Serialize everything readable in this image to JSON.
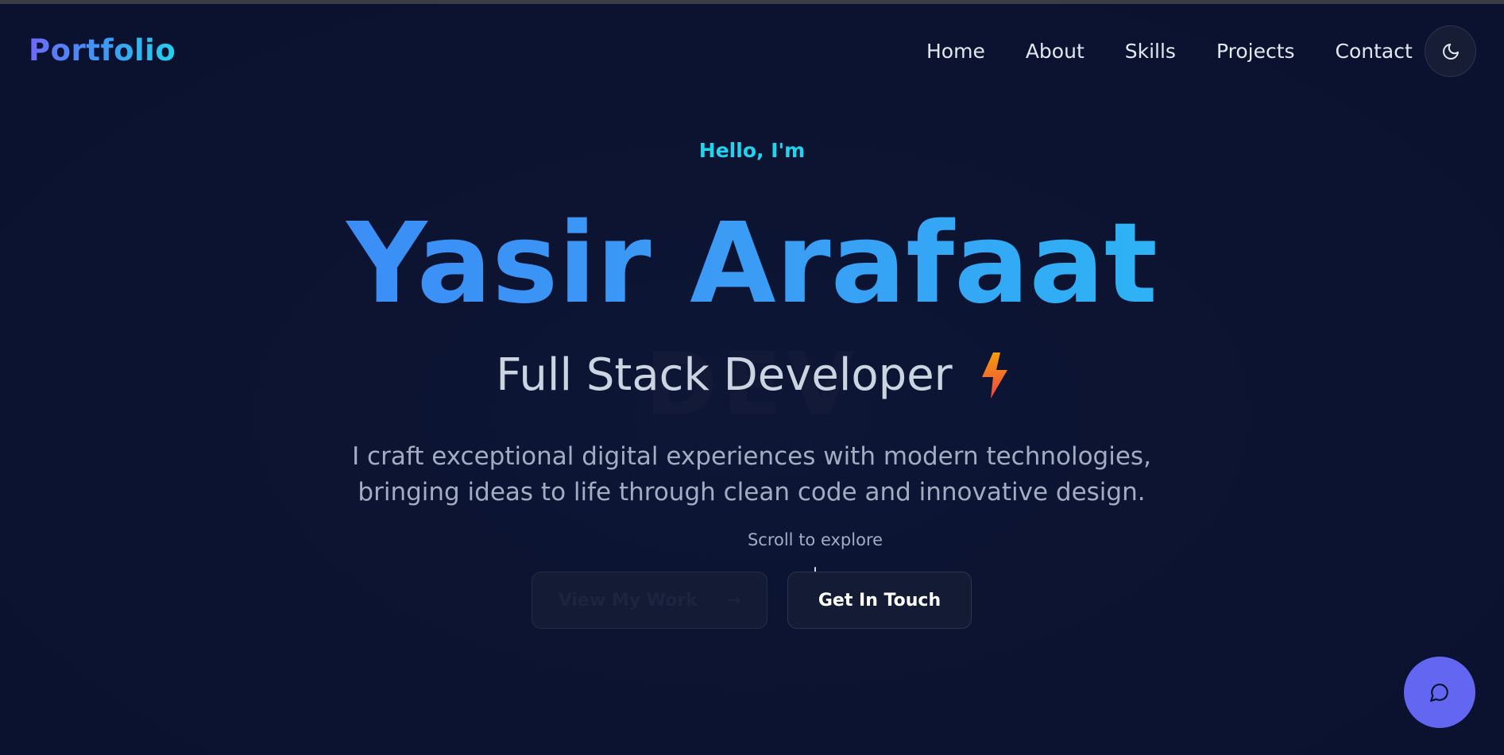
{
  "header": {
    "logo": "Portfolio",
    "nav": [
      "Home",
      "About",
      "Skills",
      "Projects",
      "Contact"
    ],
    "theme_toggle_icon": "moon-icon"
  },
  "hero": {
    "greeting": "Hello, I'm",
    "name": "Yasir Arafaat",
    "role": "Full Stack Developer",
    "role_icon": "lightning-bolt-icon",
    "description": "I craft exceptional digital experiences with modern technologies, bringing ideas to life through clean code and innovative design.",
    "scroll_hint": "Scroll to explore",
    "scroll_icon": "arrow-down-icon",
    "primary_button": "View My Work",
    "primary_button_arrow": "→",
    "secondary_button": "Get In Touch"
  },
  "chat_button_icon": "chat-bubble-icon",
  "colors": {
    "background": "#0b1330",
    "accent_cyan": "#22d3ee",
    "accent_blue": "#3b82f6",
    "chat_button": "#6366f1"
  }
}
